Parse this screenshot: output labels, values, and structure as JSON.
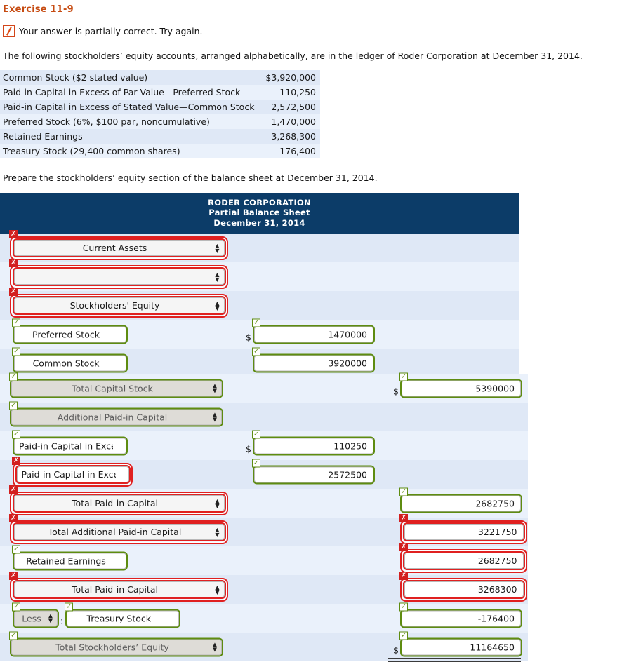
{
  "exercise": {
    "title": "Exercise 11-9",
    "status_text": "Your answer is partially correct.  Try again.",
    "status_icon": "partial-slash-icon",
    "intro": "The following stockholders’ equity accounts, arranged alphabetically, are in the ledger of Roder Corporation at December 31, 2014.",
    "prompt": "Prepare the stockholders’ equity section of the balance sheet at December 31, 2014."
  },
  "accounts": [
    {
      "name": "Common Stock ($2 stated value)",
      "amount": "$3,920,000"
    },
    {
      "name": "Paid-in Capital in Excess of Par Value—Preferred Stock",
      "amount": "110,250"
    },
    {
      "name": "Paid-in Capital in Excess of Stated Value—Common Stock",
      "amount": "2,572,500"
    },
    {
      "name": "Preferred Stock (6%, $100 par, noncumulative)",
      "amount": "1,470,000"
    },
    {
      "name": "Retained Earnings",
      "amount": "3,268,300"
    },
    {
      "name": "Treasury Stock (29,400 common shares)",
      "amount": "176,400"
    }
  ],
  "balance_sheet": {
    "header": {
      "company": "RODER CORPORATION",
      "statement": "Partial Balance Sheet",
      "date": "December 31, 2014"
    },
    "colors": {
      "header_bg": "#0c3c68",
      "row_odd": "#dfe8f6",
      "row_even": "#eaf1fb",
      "correct": "#5e8c10",
      "incorrect": "#e02020",
      "title_accent": "#c64a10"
    },
    "markers": {
      "correct": "✓",
      "incorrect": "✗"
    },
    "rows": [
      {
        "label": "Current Assets",
        "label_kind": "select",
        "label_state": "incorrect"
      },
      {
        "label": "",
        "label_kind": "select",
        "label_state": "incorrect"
      },
      {
        "label": "Stockholders' Equity",
        "label_kind": "select",
        "label_state": "incorrect"
      },
      {
        "label": "Preferred Stock",
        "label_kind": "input",
        "label_state": "correct",
        "value": "1470000",
        "value_state": "correct",
        "value_col": "mid",
        "dollar": true
      },
      {
        "label": "Common Stock",
        "label_kind": "input",
        "label_state": "correct",
        "value": "3920000",
        "value_state": "correct",
        "value_col": "mid",
        "rule": "single"
      },
      {
        "label": "Total Capital Stock",
        "label_kind": "select",
        "label_state": "correct",
        "disabled": true,
        "value": "5390000",
        "value_state": "correct",
        "value_col": "right",
        "dollar": true
      },
      {
        "label": "Additional Paid-in Capital",
        "label_kind": "select",
        "label_state": "correct",
        "disabled": true
      },
      {
        "label": "Paid-in Capital in Exces",
        "label_kind": "input",
        "label_state": "correct",
        "value": "110250",
        "value_state": "correct",
        "value_col": "mid",
        "dollar": true
      },
      {
        "label": "Paid-in Capital in Exces",
        "label_kind": "input",
        "label_state": "incorrect",
        "value": "2572500",
        "value_state": "correct",
        "value_col": "mid",
        "rule": "single"
      },
      {
        "label": "Total Paid-in Capital",
        "label_kind": "select",
        "label_state": "incorrect",
        "value": "2682750",
        "value_state": "correct",
        "value_col": "right",
        "rule": "single"
      },
      {
        "label": "Total Additional Paid-in Capital",
        "label_kind": "select",
        "label_state": "incorrect",
        "value": "3221750",
        "value_state": "incorrect",
        "value_col": "right"
      },
      {
        "label": "Retained Earnings",
        "label_kind": "input",
        "label_state": "correct",
        "value": "2682750",
        "value_state": "incorrect",
        "value_col": "right",
        "rule": "single"
      },
      {
        "label": "Total Paid-in Capital",
        "label_kind": "select",
        "label_state": "incorrect",
        "value": "3268300",
        "value_state": "incorrect",
        "value_col": "right"
      },
      {
        "label": "Treasury Stock",
        "label_kind": "input",
        "label_state": "correct",
        "prefix_select": "Less",
        "prefix_state": "correct",
        "separator": ":",
        "value": "-176400",
        "value_state": "correct",
        "value_col": "right",
        "rule": "single"
      },
      {
        "label": "Total Stockholders’ Equity",
        "label_kind": "select",
        "label_state": "correct",
        "disabled": true,
        "value": "11164650",
        "value_state": "correct",
        "value_col": "right",
        "dollar": true,
        "rule": "double"
      }
    ]
  }
}
